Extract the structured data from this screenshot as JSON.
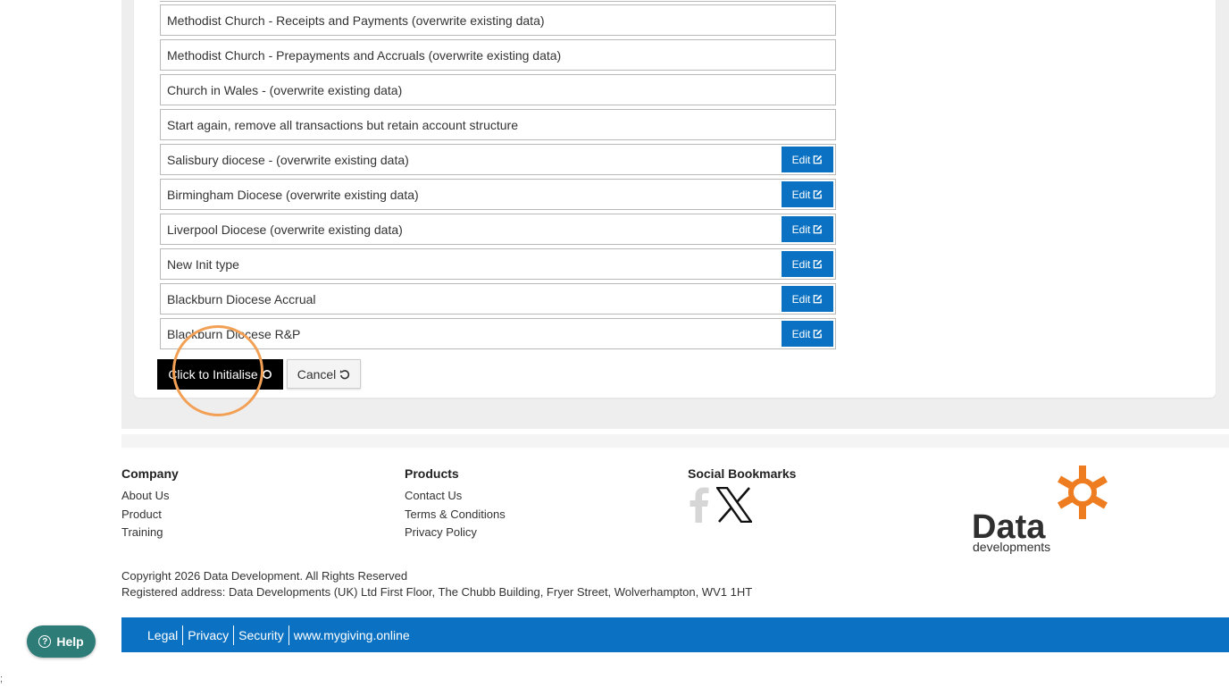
{
  "options": [
    {
      "label": "Methodist Church - Receipts and Payments (overwrite existing data)",
      "editable": false
    },
    {
      "label": "Methodist Church - Prepayments and Accruals (overwrite existing data)",
      "editable": false
    },
    {
      "label": "Church in Wales - (overwrite existing data)",
      "editable": false
    },
    {
      "label": "Start again, remove all transactions but retain account structure",
      "editable": false
    },
    {
      "label": "Salisbury diocese - (overwrite existing data)",
      "editable": true
    },
    {
      "label": "Birmingham Diocese (overwrite existing data)",
      "editable": true
    },
    {
      "label": "Liverpool Diocese (overwrite existing data)",
      "editable": true
    },
    {
      "label": "New Init type",
      "editable": true
    },
    {
      "label": "Blackburn Diocese Accrual",
      "editable": true
    },
    {
      "label": "Blackburn Diocese R&P",
      "editable": true
    }
  ],
  "edit_label": "Edit",
  "actions": {
    "initialise_label": "Click to Initialise",
    "cancel_label": "Cancel"
  },
  "footer": {
    "company": {
      "heading": "Company",
      "links": [
        "About Us",
        "Product",
        "Training"
      ]
    },
    "products": {
      "heading": "Products",
      "links": [
        "Contact Us",
        "Terms & Conditions",
        "Privacy Policy"
      ]
    },
    "social": {
      "heading": "Social Bookmarks",
      "icons": [
        "facebook-icon",
        "x-icon"
      ]
    },
    "logo": {
      "word": "Data",
      "sub": "developments"
    },
    "copyright": "Copyright 2026 Data Development. All Rights Reserved",
    "address": "Registered address: Data Developments (UK) Ltd First Floor, The Chubb Building, Fryer Street, Wolverhampton, WV1 1HT"
  },
  "bottom_bar": {
    "links": [
      "Legal",
      "Privacy",
      "Security",
      "www.mygiving.online"
    ]
  },
  "help": {
    "label": "Help"
  },
  "stray_mark": ";",
  "colors": {
    "primary_blue": "#0b72c3",
    "init_button": "#000000",
    "help_teal": "#2e7c78",
    "highlight_ring": "#f2a055",
    "logo_orange": "#ee7d22"
  }
}
